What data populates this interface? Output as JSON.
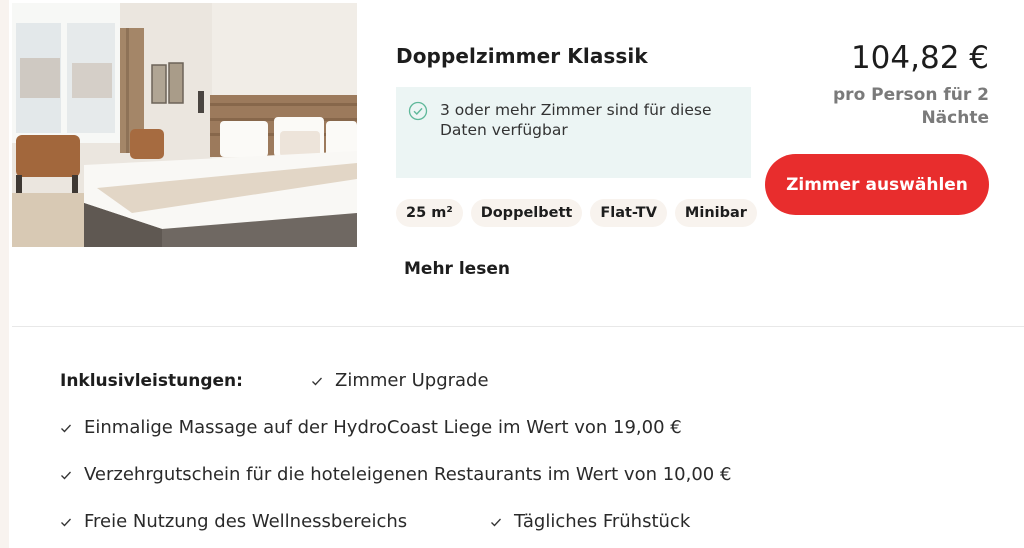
{
  "room": {
    "title": "Doppelzimmer Klassik",
    "availability": "3 oder mehr Zimmer sind für diese Daten verfügbar",
    "features": [
      "25 m²",
      "Doppelbett",
      "Flat-TV",
      "Minibar"
    ],
    "read_more": "Mehr lesen"
  },
  "pricing": {
    "price": "104,82 €",
    "note": "pro Person für 2 Nächte",
    "select_label": "Zimmer auswählen"
  },
  "inclusions": {
    "label": "Inklusivleistungen:",
    "items": [
      "Zimmer Upgrade",
      "Einmalige Massage auf der HydroCoast Liege im Wert von 19,00 €",
      "Verzehrgutschein für die hoteleigenen Restaurants im Wert von 10,00 €",
      "Freie Nutzung des Wellnessbereichs",
      "Tägliches Frühstück"
    ]
  },
  "colors": {
    "accent": "#e82d2d",
    "availability_bg": "#ecf5f4",
    "availability_icon": "#5fb89a",
    "tag_bg": "#f8f3ee",
    "muted_text": "#7a7a7a"
  },
  "icons": {
    "availability": "check-circle-icon",
    "inclusion": "checkmark-icon"
  }
}
